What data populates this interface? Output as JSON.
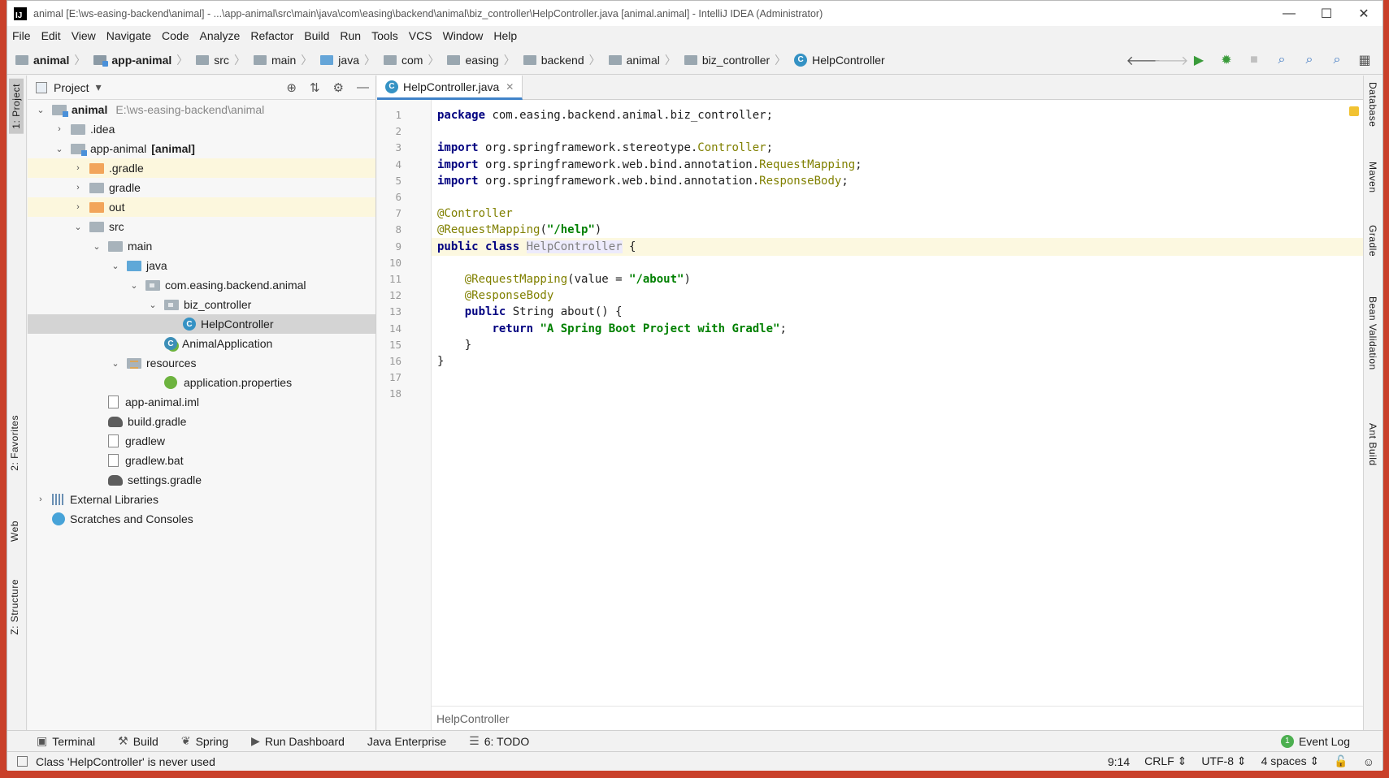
{
  "window": {
    "title": "animal [E:\\ws-easing-backend\\animal] - ...\\app-animal\\src\\main\\java\\com\\easing\\backend\\animal\\biz_controller\\HelpController.java [animal.animal] - IntelliJ IDEA (Administrator)",
    "logo": "IJ",
    "minimize": "—",
    "maximize": "☐",
    "close": "✕"
  },
  "menu": [
    "File",
    "Edit",
    "View",
    "Navigate",
    "Code",
    "Analyze",
    "Refactor",
    "Build",
    "Run",
    "Tools",
    "VCS",
    "Window",
    "Help"
  ],
  "breadcrumb": [
    {
      "label": "animal",
      "bold": true,
      "icon": "folder-icon"
    },
    {
      "label": "app-animal",
      "bold": true,
      "icon": "module-icon"
    },
    {
      "label": "src",
      "icon": "folder-icon"
    },
    {
      "label": "main",
      "icon": "folder-icon"
    },
    {
      "label": "java",
      "icon": "source-folder-icon"
    },
    {
      "label": "com",
      "icon": "folder-icon"
    },
    {
      "label": "easing",
      "icon": "folder-icon"
    },
    {
      "label": "backend",
      "icon": "folder-icon"
    },
    {
      "label": "animal",
      "icon": "folder-icon"
    },
    {
      "label": "biz_controller",
      "icon": "folder-icon"
    },
    {
      "label": "HelpController",
      "icon": "class-icon"
    }
  ],
  "nav_tools": {
    "back": "🡐",
    "forward": "🡒",
    "run": "▶",
    "debug": "✹",
    "stop": "■",
    "search1": "⌕",
    "search2": "⌕",
    "search3": "⌕",
    "structure": "▦"
  },
  "left_stripe": {
    "project": "1: Project",
    "favorites": "2: Favorites",
    "web": "Web",
    "structure": "Z: Structure"
  },
  "right_stripe": [
    "Database",
    "Maven",
    "Gradle",
    "Bean Validation",
    "Ant Build"
  ],
  "project_panel": {
    "title": "Project",
    "dropdown": "▾",
    "tools": [
      "⊕",
      "⇅",
      "⚙",
      "—"
    ],
    "tree": [
      {
        "label": "animal",
        "extra": "E:\\ws-easing-backend\\animal",
        "indent": 0,
        "arrow": "⌄",
        "icon": "module",
        "bold": true
      },
      {
        "label": ".idea",
        "indent": 1,
        "arrow": "›",
        "icon": "folder"
      },
      {
        "label": "app-animal",
        "extra_bold": "[animal]",
        "indent": 1,
        "arrow": "⌄",
        "icon": "module"
      },
      {
        "label": ".gradle",
        "indent": 2,
        "arrow": "›",
        "icon": "folder-orange",
        "highlight": true
      },
      {
        "label": "gradle",
        "indent": 2,
        "arrow": "›",
        "icon": "folder"
      },
      {
        "label": "out",
        "indent": 2,
        "arrow": "›",
        "icon": "folder-orange",
        "highlight": true
      },
      {
        "label": "src",
        "indent": 2,
        "arrow": "⌄",
        "icon": "folder"
      },
      {
        "label": "main",
        "indent": 3,
        "arrow": "⌄",
        "icon": "folder"
      },
      {
        "label": "java",
        "indent": 4,
        "arrow": "⌄",
        "icon": "folder-blue"
      },
      {
        "label": "com.easing.backend.animal",
        "indent": 5,
        "arrow": "⌄",
        "icon": "package"
      },
      {
        "label": "biz_controller",
        "indent": 6,
        "arrow": "⌄",
        "icon": "package"
      },
      {
        "label": "HelpController",
        "indent": 7,
        "arrow": "",
        "icon": "class",
        "selected": true
      },
      {
        "label": "AnimalApplication",
        "indent": 6,
        "arrow": "",
        "icon": "spring-class"
      },
      {
        "label": "resources",
        "indent": 4,
        "arrow": "⌄",
        "icon": "resources"
      },
      {
        "label": "application.properties",
        "indent": 6,
        "arrow": "",
        "icon": "spring-props"
      },
      {
        "label": "app-animal.iml",
        "indent": 3,
        "arrow": "",
        "icon": "doc"
      },
      {
        "label": "build.gradle",
        "indent": 3,
        "arrow": "",
        "icon": "gradle"
      },
      {
        "label": "gradlew",
        "indent": 3,
        "arrow": "",
        "icon": "doc"
      },
      {
        "label": "gradlew.bat",
        "indent": 3,
        "arrow": "",
        "icon": "doc"
      },
      {
        "label": "settings.gradle",
        "indent": 3,
        "arrow": "",
        "icon": "gradle"
      },
      {
        "label": "External Libraries",
        "indent": 0,
        "arrow": "›",
        "icon": "libraries"
      },
      {
        "label": "Scratches and Consoles",
        "indent": 0,
        "arrow": "",
        "icon": "scratches"
      }
    ]
  },
  "editor": {
    "tab_label": "HelpController.java",
    "tab_icon": "C",
    "tab_close": "✕",
    "footer_crumb": "HelpController",
    "current_line": 9,
    "lines": [
      {
        "n": "1",
        "html": "<span class=\"kw\">package</span> com.easing.backend.animal.biz_controller;"
      },
      {
        "n": "2",
        "html": ""
      },
      {
        "n": "3",
        "html": "<span class=\"kw\">import</span> org.springframework.stereotype.<span class=\"ann\">Controller</span>;"
      },
      {
        "n": "4",
        "html": "<span class=\"kw\">import</span> org.springframework.web.bind.annotation.<span class=\"ann\">RequestMapping</span>;"
      },
      {
        "n": "5",
        "html": "<span class=\"kw\">import</span> org.springframework.web.bind.annotation.<span class=\"ann\">ResponseBody</span>;"
      },
      {
        "n": "6",
        "html": ""
      },
      {
        "n": "7",
        "html": "<span class=\"ann\">@Controller</span>"
      },
      {
        "n": "8",
        "html": "<span class=\"ann\">@RequestMapping</span>(<span class=\"str\">\"/help\"</span>)"
      },
      {
        "n": "9",
        "html": "<span class=\"kw\">public class</span> <span class=\"unused\">HelpController</span> {"
      },
      {
        "n": "10",
        "html": ""
      },
      {
        "n": "11",
        "html": "    <span class=\"ann\">@RequestMapping</span>(value = <span class=\"str\">\"/about\"</span>)"
      },
      {
        "n": "12",
        "html": "    <span class=\"ann\">@ResponseBody</span>"
      },
      {
        "n": "13",
        "html": "    <span class=\"kw\">public</span> String about() {"
      },
      {
        "n": "14",
        "html": "        <span class=\"kw\">return</span> <span class=\"str\">\"A Spring Boot Project with Gradle\"</span>;"
      },
      {
        "n": "15",
        "html": "    }"
      },
      {
        "n": "16",
        "html": "}"
      },
      {
        "n": "17",
        "html": ""
      },
      {
        "n": "18",
        "html": ""
      }
    ]
  },
  "bottom_tools": [
    {
      "icon": "▣",
      "label": "Terminal"
    },
    {
      "icon": "⚒",
      "label": "Build"
    },
    {
      "icon": "❦",
      "label": "Spring"
    },
    {
      "icon": "▶",
      "label": "Run Dashboard"
    },
    {
      "icon": "",
      "label": "Java Enterprise"
    },
    {
      "icon": "☰",
      "label": "6: TODO"
    }
  ],
  "event_log": {
    "badge": "1",
    "label": "Event Log"
  },
  "status": {
    "message": "Class 'HelpController' is never used",
    "position": "9:14",
    "line_sep": "CRLF ⇕",
    "encoding": "UTF-8 ⇕",
    "indent": "4 spaces ⇕",
    "lock": "🔓",
    "inspector": "☺"
  },
  "colors": {
    "accent": "#4083c9",
    "class_icon": "#3592c4",
    "keyword": "#000080",
    "annotation": "#808000",
    "string": "#008000"
  }
}
